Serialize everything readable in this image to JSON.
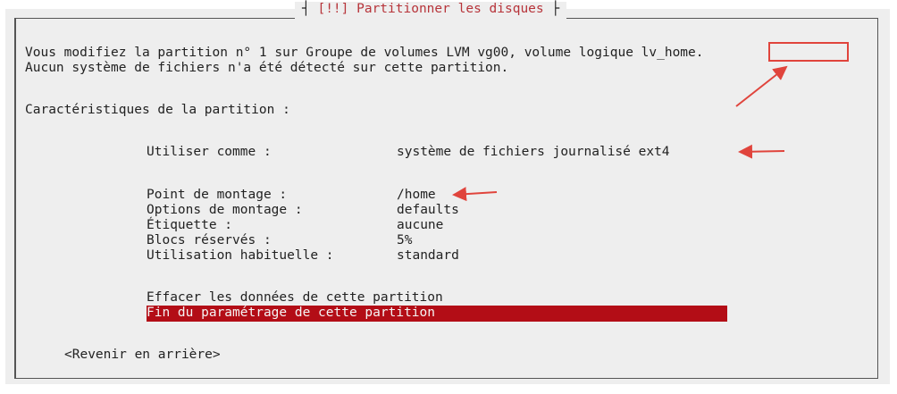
{
  "window": {
    "title": "[!!] Partitionner les disques"
  },
  "intro": {
    "line1_prefix": "Vous modifiez la partition n° 1 sur Groupe de volumes LVM vg00, volume logique ",
    "line1_volume": "lv_home.",
    "line2": "Aucun système de fichiers n'a été détecté sur cette partition."
  },
  "section_label": "Caractéristiques de la partition :",
  "settings": [
    {
      "label": "Utiliser comme :",
      "value": "système de fichiers journalisé ext4"
    },
    {
      "label": "Point de montage :",
      "value": "/home"
    },
    {
      "label": "Options de montage :",
      "value": "defaults"
    },
    {
      "label": "Étiquette :",
      "value": "aucune"
    },
    {
      "label": "Blocs réservés :",
      "value": "5%"
    },
    {
      "label": "Utilisation habituelle :",
      "value": "standard"
    }
  ],
  "actions": {
    "erase": "Effacer les données de cette partition",
    "finish": "Fin du paramétrage de cette partition",
    "back": "<Revenir en arrière>"
  },
  "colors": {
    "highlight": "#b30d16",
    "annotation": "#e0443c",
    "title": "#b7343a",
    "background": "#eeeeee"
  }
}
